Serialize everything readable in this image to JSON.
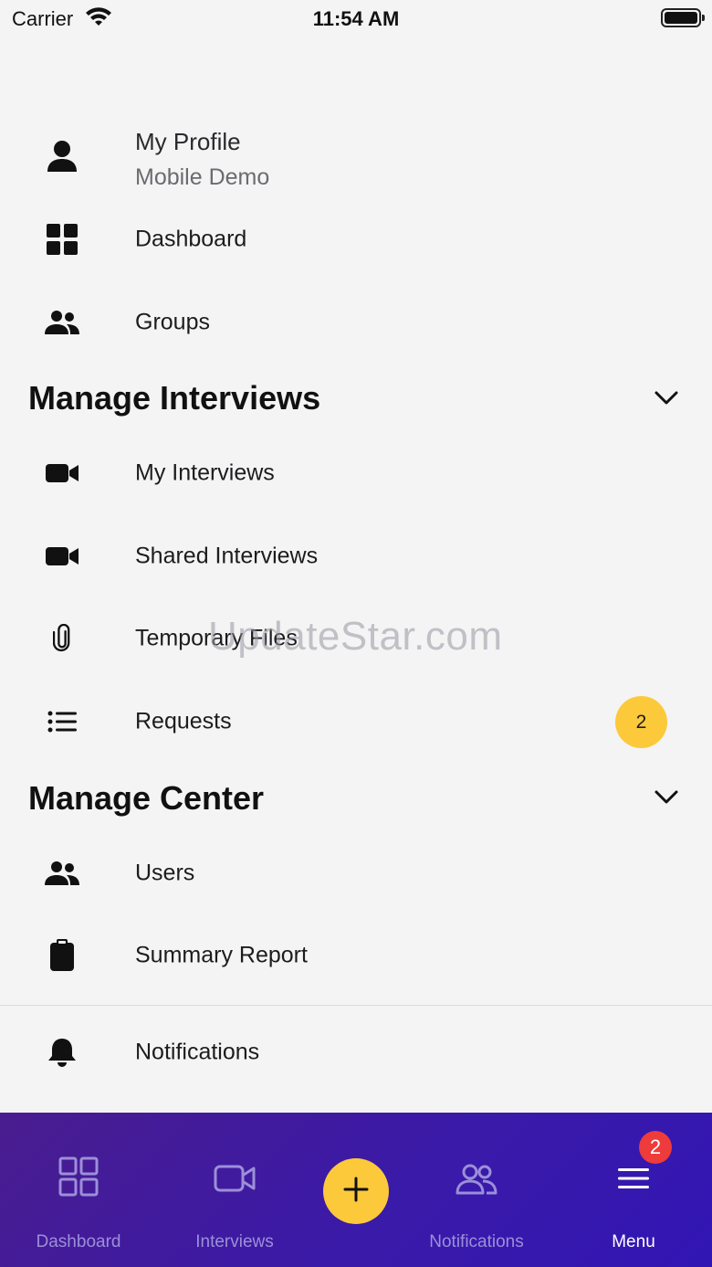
{
  "status_bar": {
    "carrier": "Carrier",
    "time": "11:54 AM"
  },
  "profile": {
    "title": "My Profile",
    "subtitle": "Mobile Demo",
    "icon": "person-icon"
  },
  "menu": {
    "dashboard": {
      "label": "Dashboard",
      "icon": "grid-icon"
    },
    "groups": {
      "label": "Groups",
      "icon": "people-icon"
    }
  },
  "manage_interviews": {
    "title": "Manage Interviews",
    "items": [
      {
        "label": "My Interviews",
        "icon": "video-icon"
      },
      {
        "label": "Shared Interviews",
        "icon": "video-icon"
      },
      {
        "label": "Temporary Files",
        "icon": "paperclip-icon"
      },
      {
        "label": "Requests",
        "icon": "list-icon",
        "badge": "2"
      }
    ]
  },
  "manage_center": {
    "title": "Manage Center",
    "items": [
      {
        "label": "Users",
        "icon": "people-icon"
      },
      {
        "label": "Summary Report",
        "icon": "clipboard-icon"
      }
    ]
  },
  "notifications_row": {
    "label": "Notifications",
    "icon": "bell-icon"
  },
  "watermark": "UpdateStar.com",
  "tab_bar": {
    "dashboard": "Dashboard",
    "interviews": "Interviews",
    "notifications": "Notifications",
    "menu": "Menu",
    "menu_badge": "2"
  },
  "colors": {
    "accent_yellow": "#fcc93a",
    "tab_bar_purple": "#3a1aa8",
    "badge_red": "#ee3b3b"
  }
}
